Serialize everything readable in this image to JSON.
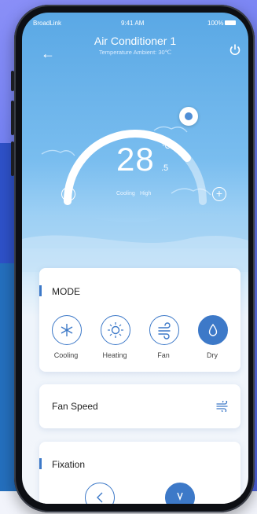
{
  "statusbar": {
    "carrier": "BroadLink",
    "time": "9:41 AM",
    "battery": "100%"
  },
  "header": {
    "title": "Air Conditioner 1",
    "subtitle": "Temperature Ambient: 30℃"
  },
  "thermostat": {
    "temperature": "28",
    "decimal": ".5",
    "unit": "℃",
    "mode": "Cooling",
    "speed": "High",
    "level": 0.78
  },
  "mode_card": {
    "title": "MODE",
    "modes": [
      {
        "label": "Cooling",
        "icon": "snowflake-icon",
        "active": false
      },
      {
        "label": "Heating",
        "icon": "sun-icon",
        "active": false
      },
      {
        "label": "Fan",
        "icon": "wind-icon",
        "active": false
      },
      {
        "label": "Dry",
        "icon": "droplet-icon",
        "active": true
      }
    ]
  },
  "fan_speed": {
    "title": "Fan Speed"
  },
  "fixation": {
    "title": "Fixation"
  },
  "colors": {
    "accent": "#3d79c8",
    "sky": "#5aa8e5"
  }
}
